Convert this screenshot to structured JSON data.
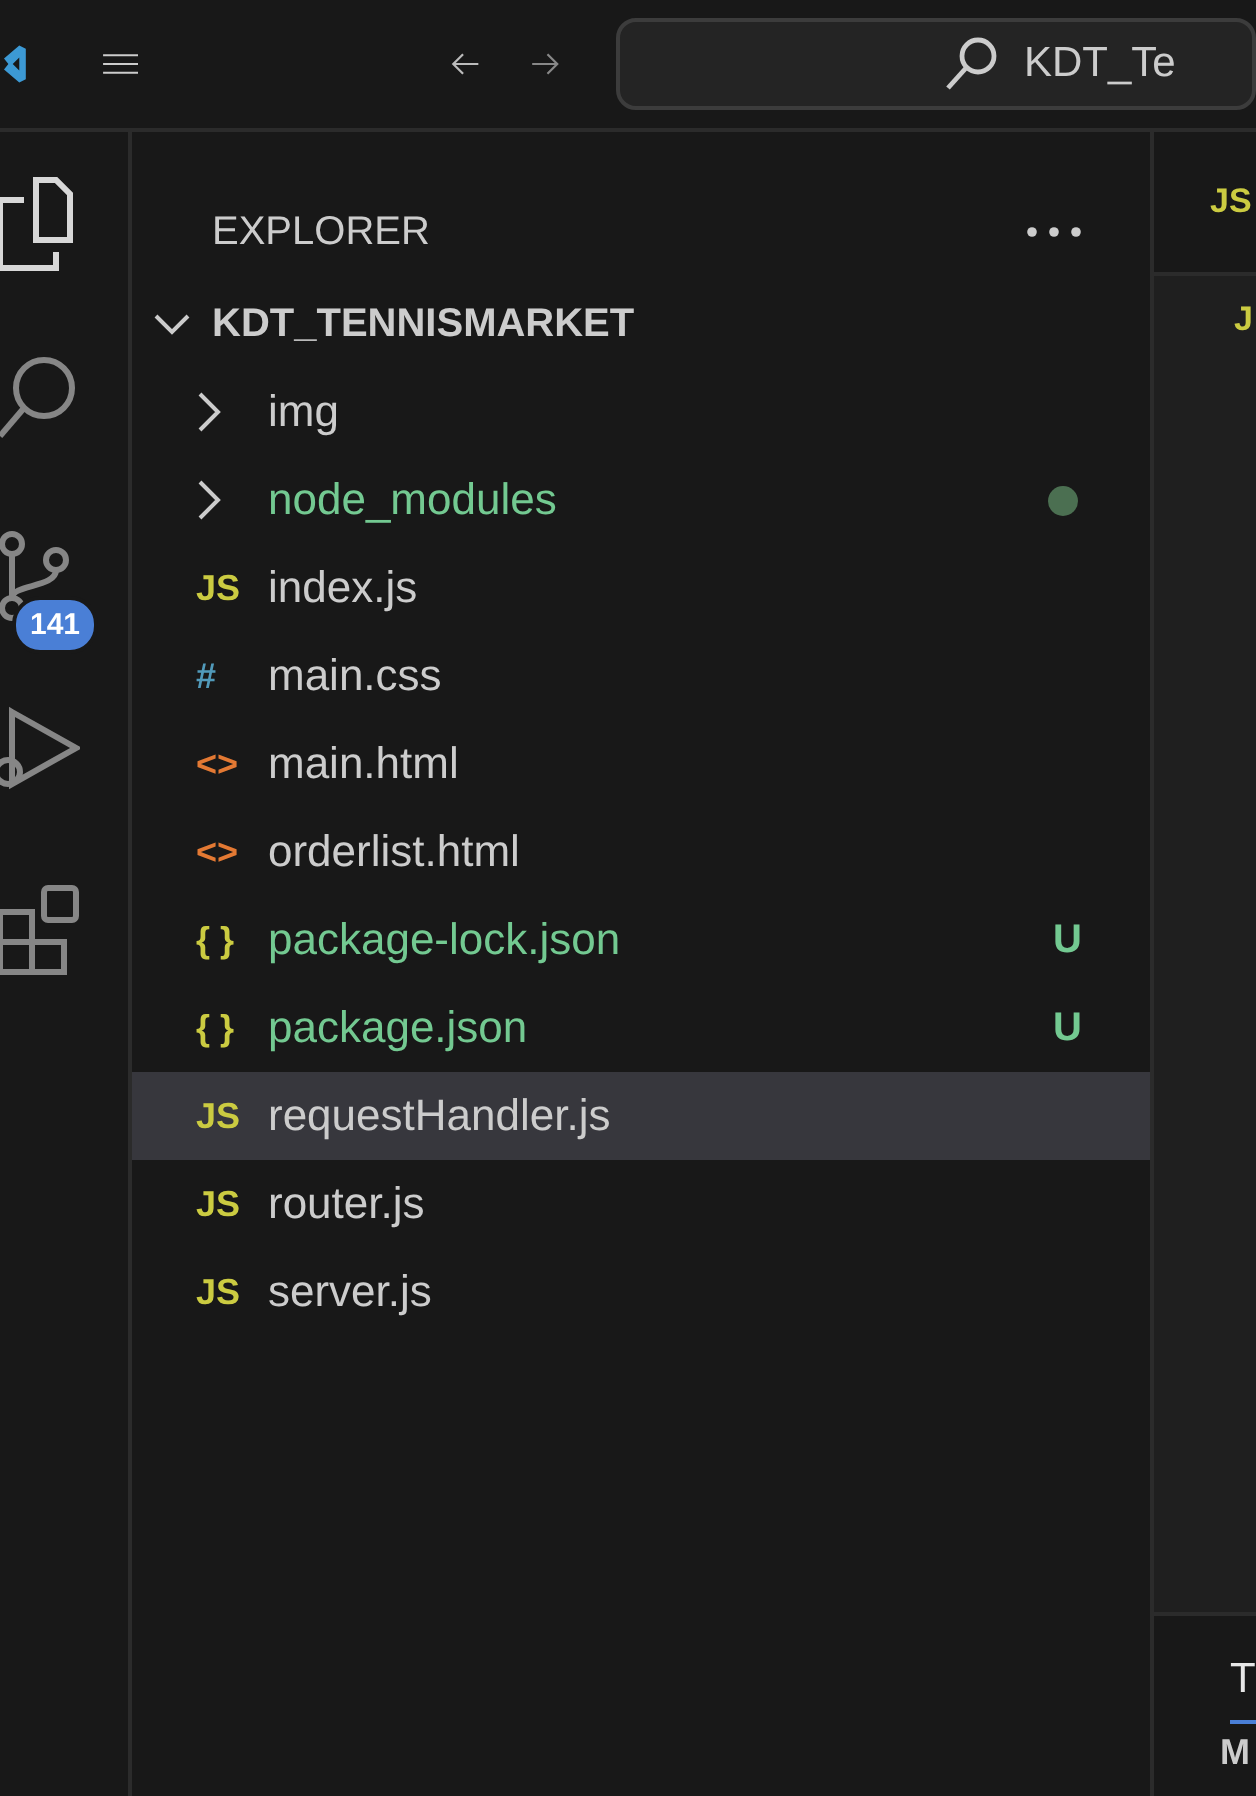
{
  "title_bar": {
    "search_text": "KDT_Te"
  },
  "activity_bar": {
    "items": [
      {
        "kind": "explorer",
        "selected": true
      },
      {
        "kind": "search",
        "selected": false
      },
      {
        "kind": "source_control",
        "selected": false,
        "badge": "141"
      },
      {
        "kind": "run_debug",
        "selected": false
      },
      {
        "kind": "extensions",
        "selected": false
      }
    ]
  },
  "sidebar": {
    "title": "EXPLORER",
    "root": {
      "label": "KDT_TENNISMARKET",
      "expanded": true,
      "children": [
        {
          "kind": "folder",
          "label": "img",
          "expanded": false,
          "untracked": false,
          "selected": false
        },
        {
          "kind": "folder",
          "label": "node_modules",
          "expanded": false,
          "untracked": true,
          "dot": true,
          "selected": false
        },
        {
          "kind": "js",
          "icon": "JS",
          "label": "index.js",
          "untracked": false,
          "selected": false
        },
        {
          "kind": "css",
          "icon": "#",
          "label": "main.css",
          "untracked": false,
          "selected": false
        },
        {
          "kind": "html",
          "icon": "<>",
          "label": "main.html",
          "untracked": false,
          "selected": false
        },
        {
          "kind": "html",
          "icon": "<>",
          "label": "orderlist.html",
          "untracked": false,
          "selected": false
        },
        {
          "kind": "json",
          "icon": "{ }",
          "label": "package-lock.json",
          "untracked": true,
          "decoration": "U",
          "selected": false
        },
        {
          "kind": "json",
          "icon": "{ }",
          "label": "package.json",
          "untracked": true,
          "decoration": "U",
          "selected": false
        },
        {
          "kind": "js",
          "icon": "JS",
          "label": "requestHandler.js",
          "untracked": false,
          "selected": true
        },
        {
          "kind": "js",
          "icon": "JS",
          "label": "router.js",
          "untracked": false,
          "selected": false
        },
        {
          "kind": "js",
          "icon": "JS",
          "label": "server.js",
          "untracked": false,
          "selected": false
        }
      ]
    }
  },
  "editor": {
    "tab_icon": "JS",
    "breadcrumb_icon": "J"
  },
  "panel": {
    "tabs": [
      {
        "label": "T",
        "selected": true
      }
    ],
    "row_text": "M"
  }
}
